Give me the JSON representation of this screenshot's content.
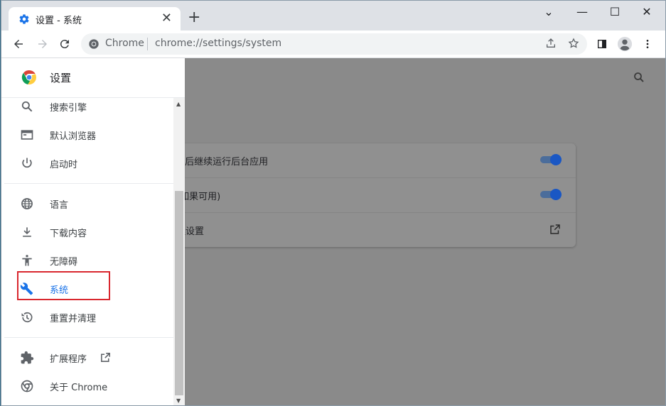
{
  "tab": {
    "title": "设置 - 系统",
    "close": "✕"
  },
  "newtab_label": "+",
  "window_controls": {
    "tabsearch": "⌄",
    "minimize": "—",
    "maximize": "☐",
    "close": "✕"
  },
  "omnibox": {
    "site": "Chrome",
    "url": "chrome://settings/system"
  },
  "drawer": {
    "title": "设置",
    "items": [
      {
        "label": "搜索引擎",
        "icon": "search-icon"
      },
      {
        "label": "默认浏览器",
        "icon": "browser-icon"
      },
      {
        "label": "启动时",
        "icon": "power-icon"
      },
      {
        "label": "语言",
        "icon": "globe-icon"
      },
      {
        "label": "下载内容",
        "icon": "download-icon"
      },
      {
        "label": "无障碍",
        "icon": "accessibility-icon"
      },
      {
        "label": "系统",
        "icon": "wrench-icon",
        "active": true
      },
      {
        "label": "重置并清理",
        "icon": "history-icon"
      },
      {
        "label": "扩展程序",
        "icon": "puzzle-icon"
      },
      {
        "label": "关于 Chrome",
        "icon": "chrome-icon"
      }
    ]
  },
  "content": {
    "rows": [
      {
        "label": "e 后继续运行后台应用",
        "control": "toggle",
        "on": true
      },
      {
        "label": "(如果可用)",
        "control": "toggle",
        "on": true
      },
      {
        "label": "理设置",
        "control": "external-link"
      }
    ]
  },
  "colors": {
    "accent": "#1a73e8",
    "highlight_border": "#d9272e",
    "overlay": "#8a8a8a"
  }
}
